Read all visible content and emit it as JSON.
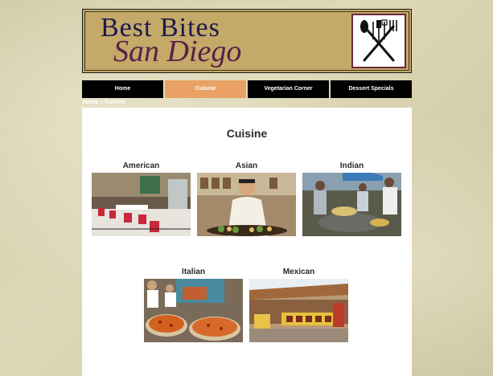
{
  "header": {
    "logo_line1": "Best Bites",
    "logo_line2": "San Diego",
    "logo_icon": "utensils-crossed-icon"
  },
  "nav": {
    "items": [
      {
        "label": "Home",
        "active": false
      },
      {
        "label": "Cuisine",
        "active": true
      },
      {
        "label": "Vegetarian Corner",
        "active": false
      },
      {
        "label": "Dessert Specials",
        "active": false
      }
    ]
  },
  "breadcrumb": {
    "home": "Home",
    "separator": "»",
    "current": "Cuisine"
  },
  "main": {
    "title": "Cuisine",
    "cuisines": [
      {
        "label": "American"
      },
      {
        "label": "Asian"
      },
      {
        "label": "Indian"
      },
      {
        "label": "Italian"
      },
      {
        "label": "Mexican"
      }
    ]
  },
  "colors": {
    "banner": "#c4a968",
    "nav_bg": "#000000",
    "nav_active": "#e9a165",
    "logo_blue": "#1d1a4d",
    "logo_purple": "#5a1f4a"
  }
}
